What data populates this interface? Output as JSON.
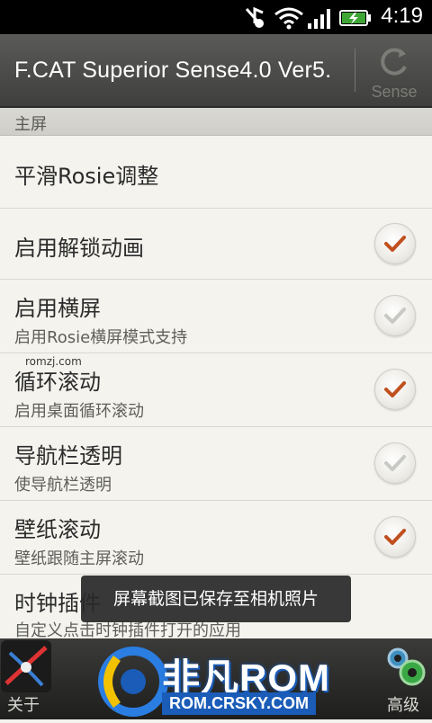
{
  "status_bar": {
    "time": "4:19"
  },
  "action_bar": {
    "title": "F.CAT Superior Sense4.0 Ver5.",
    "sense_label": "Sense"
  },
  "section": {
    "title": "主屏"
  },
  "rows": [
    {
      "title": "平滑Rosie调整",
      "subtitle": "",
      "checked": null
    },
    {
      "title": "启用解锁动画",
      "subtitle": "",
      "checked": true
    },
    {
      "title": "启用横屏",
      "subtitle": "启用Rosie横屏模式支持",
      "checked": false
    },
    {
      "title": "循环滚动",
      "subtitle": "启用桌面循环滚动",
      "checked": true
    },
    {
      "title": "导航栏透明",
      "subtitle": "使导航栏透明",
      "checked": false
    },
    {
      "title": "壁纸滚动",
      "subtitle": "壁纸跟随主屏滚动",
      "checked": true
    },
    {
      "title": "时钟插件",
      "subtitle": "自定义点击时钟插件打开的应用",
      "checked": null
    }
  ],
  "toast": {
    "text": "屏幕截图已保存至相机照片"
  },
  "bottom_bar": {
    "left_label": "关于",
    "right_label": "高级"
  },
  "watermark": {
    "brand": "非凡ROM",
    "url": "ROM.CRSKY.COM",
    "small": "romzj.com"
  },
  "colors": {
    "check_accent": "#c0501e",
    "check_off": "#c8c8c4"
  }
}
